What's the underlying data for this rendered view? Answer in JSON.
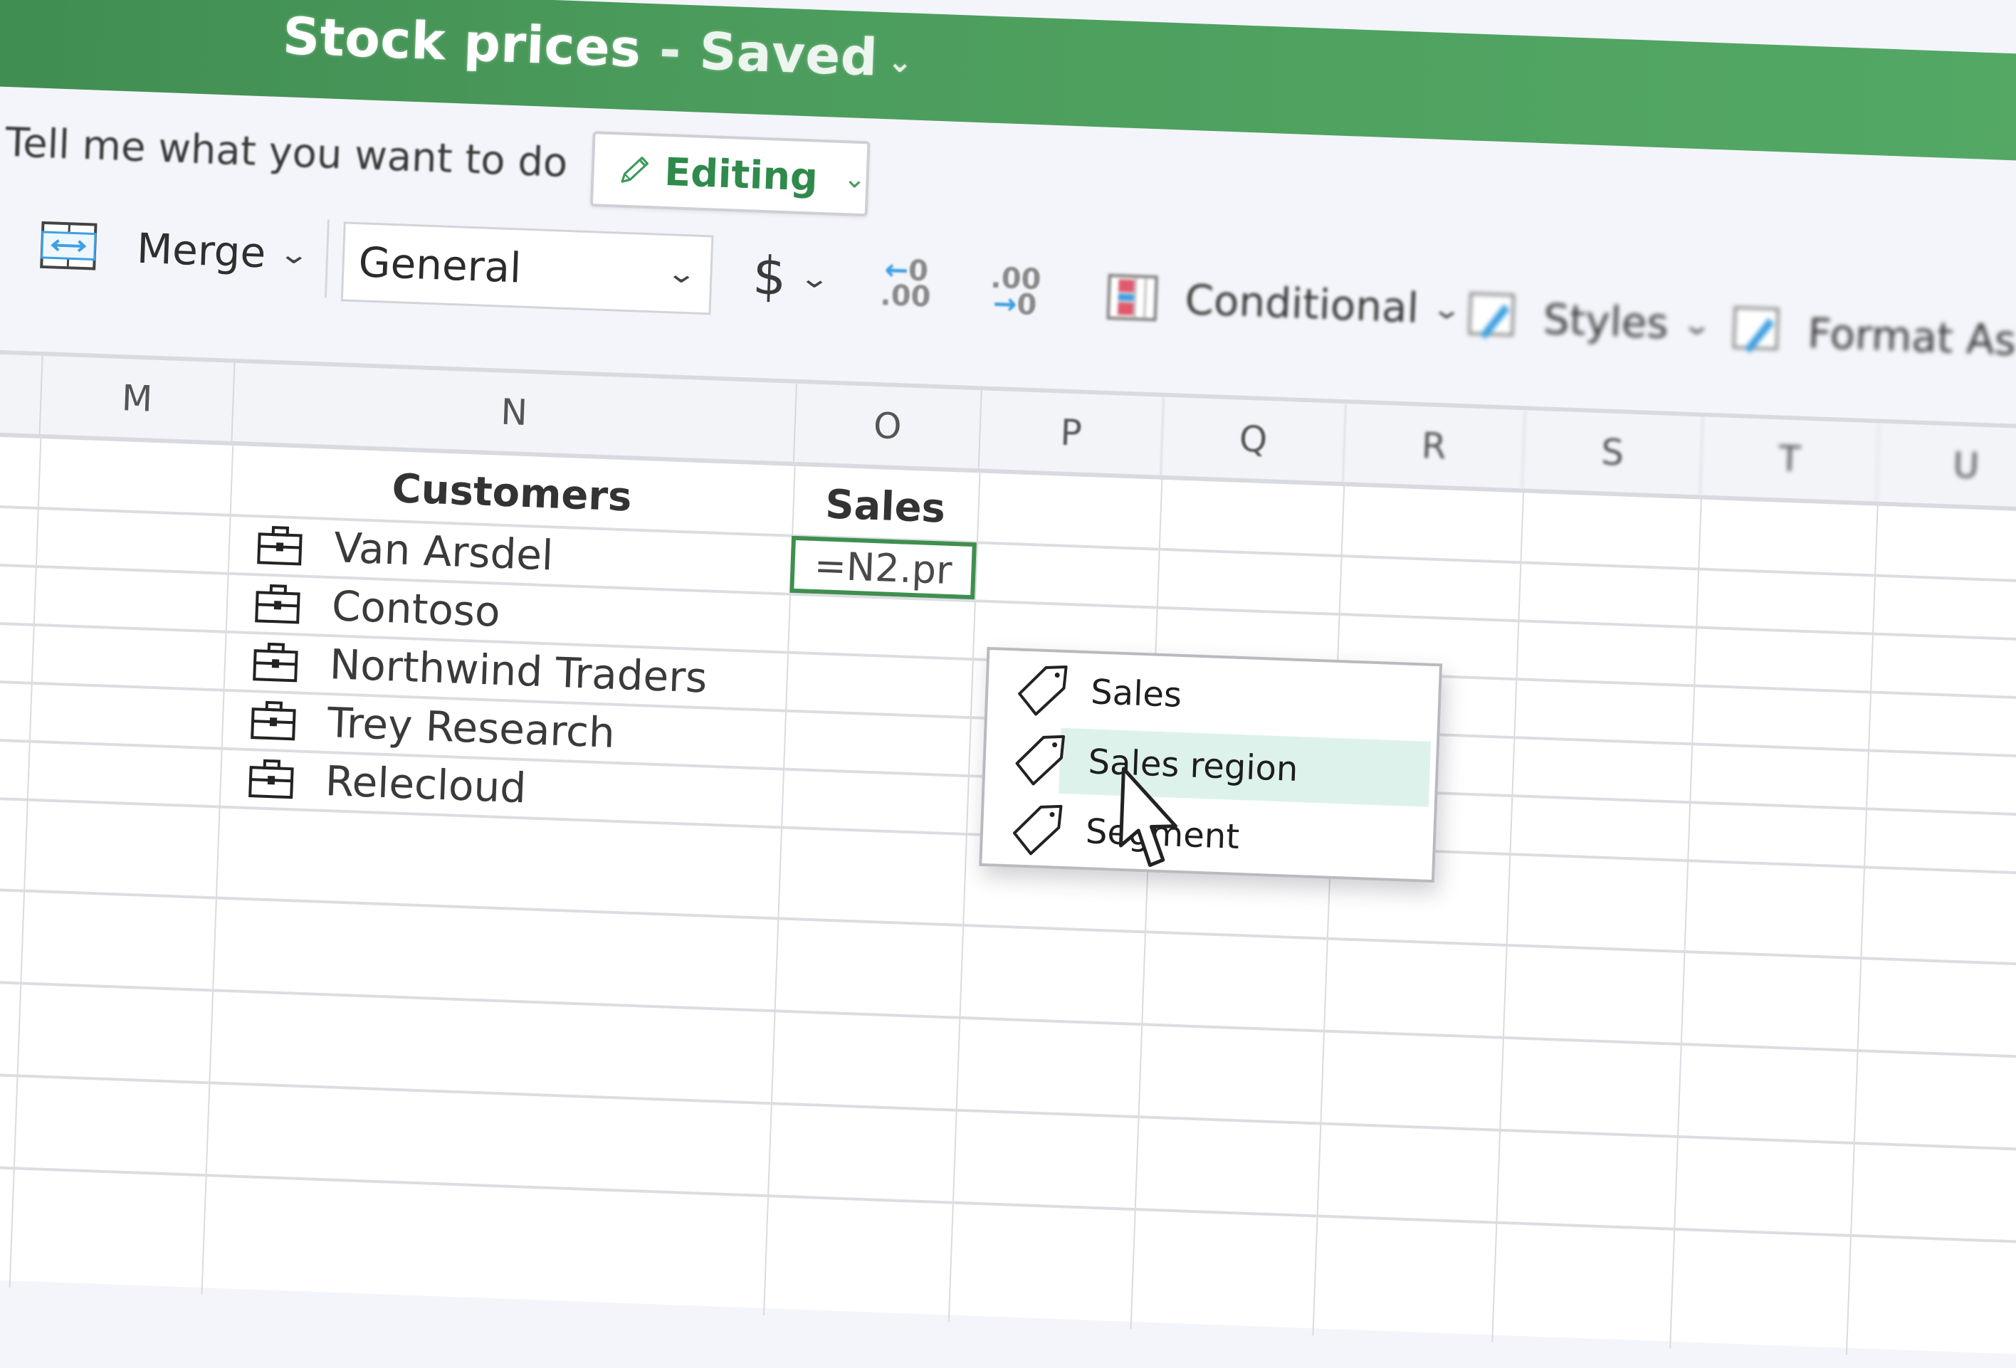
{
  "app": {
    "title": "Stock prices",
    "separator": "-",
    "save_status": "Saved",
    "brand_color": "#4c9d5d",
    "accent_color": "#2f8a4b"
  },
  "tellme": {
    "icon": "lightbulb-icon",
    "placeholder": "Tell me what you want to do"
  },
  "mode": {
    "icon": "pencil-icon",
    "label": "Editing"
  },
  "ribbon": {
    "merge": {
      "icon": "merge-cells-icon",
      "label": "Merge"
    },
    "number_format": {
      "value": "General"
    },
    "currency": {
      "label": "$"
    },
    "increase_decimal": {
      "icon": "increase-decimal-icon",
      "top": "0",
      "bottom": ".00"
    },
    "decrease_decimal": {
      "icon": "decrease-decimal-icon",
      "top": ".00",
      "bottom": "0"
    },
    "conditional": {
      "icon": "conditional-formatting-icon",
      "label": "Conditional"
    },
    "styles": {
      "icon": "cell-styles-icon",
      "label": "Styles"
    },
    "format_as": {
      "icon": "format-as-table-icon",
      "label": "Format As"
    }
  },
  "sheet": {
    "columns": [
      "M",
      "N",
      "O",
      "P",
      "Q",
      "R",
      "S",
      "T",
      "U"
    ],
    "headers": {
      "N": "Customers",
      "O": "Sales"
    },
    "customers": [
      {
        "icon": "briefcase-icon",
        "name": "Van Arsdel"
      },
      {
        "icon": "briefcase-icon",
        "name": "Contoso"
      },
      {
        "icon": "briefcase-icon",
        "name": "Northwind Traders"
      },
      {
        "icon": "briefcase-icon",
        "name": "Trey Research"
      },
      {
        "icon": "briefcase-icon",
        "name": "Relecloud"
      }
    ],
    "active_cell": {
      "ref": "O2",
      "value": "=N2.pr"
    }
  },
  "autocomplete": {
    "items": [
      {
        "icon": "tag-icon",
        "label": "Sales",
        "highlighted": false
      },
      {
        "icon": "tag-icon",
        "label": "Sales region",
        "highlighted": true
      },
      {
        "icon": "tag-icon",
        "label": "Segment",
        "highlighted": false
      }
    ],
    "highlight_color": "#def2ec"
  }
}
